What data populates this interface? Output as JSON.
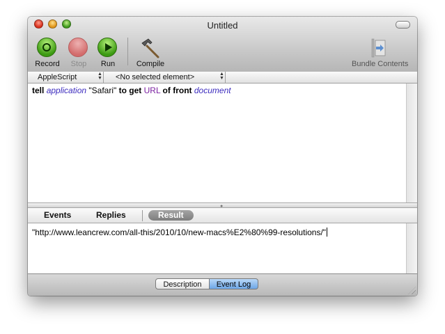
{
  "window": {
    "title": "Untitled"
  },
  "toolbar": {
    "record_label": "Record",
    "stop_label": "Stop",
    "run_label": "Run",
    "compile_label": "Compile",
    "bundle_label": "Bundle Contents"
  },
  "popups": {
    "language": "AppleScript",
    "element": "<No selected element>"
  },
  "script": {
    "tokens": [
      {
        "text": "tell",
        "kind": "keyword"
      },
      {
        "text": "application",
        "kind": "class"
      },
      {
        "text": "\"Safari\"",
        "kind": "string"
      },
      {
        "text": "to get",
        "kind": "keyword"
      },
      {
        "text": "URL",
        "kind": "property"
      },
      {
        "text": "of front",
        "kind": "keyword"
      },
      {
        "text": "document",
        "kind": "class"
      }
    ]
  },
  "log_tabs": {
    "events": "Events",
    "replies": "Replies",
    "result": "Result",
    "selected": "Result"
  },
  "result": {
    "text": "\"http://www.leancrew.com/all-this/2010/10/new-macs%E2%80%99-resolutions/\""
  },
  "bottom": {
    "description_label": "Description",
    "event_log_label": "Event Log",
    "selected": "Event Log"
  },
  "colors": {
    "keyword": "#000000",
    "class": "#3c2cbe",
    "property": "#7a1ea0",
    "selected_segment": "#6da6e6"
  },
  "icons": {
    "record": "record-icon",
    "stop": "stop-icon",
    "run": "run-icon",
    "compile": "hammer-icon",
    "bundle": "bundle-contents-icon"
  }
}
